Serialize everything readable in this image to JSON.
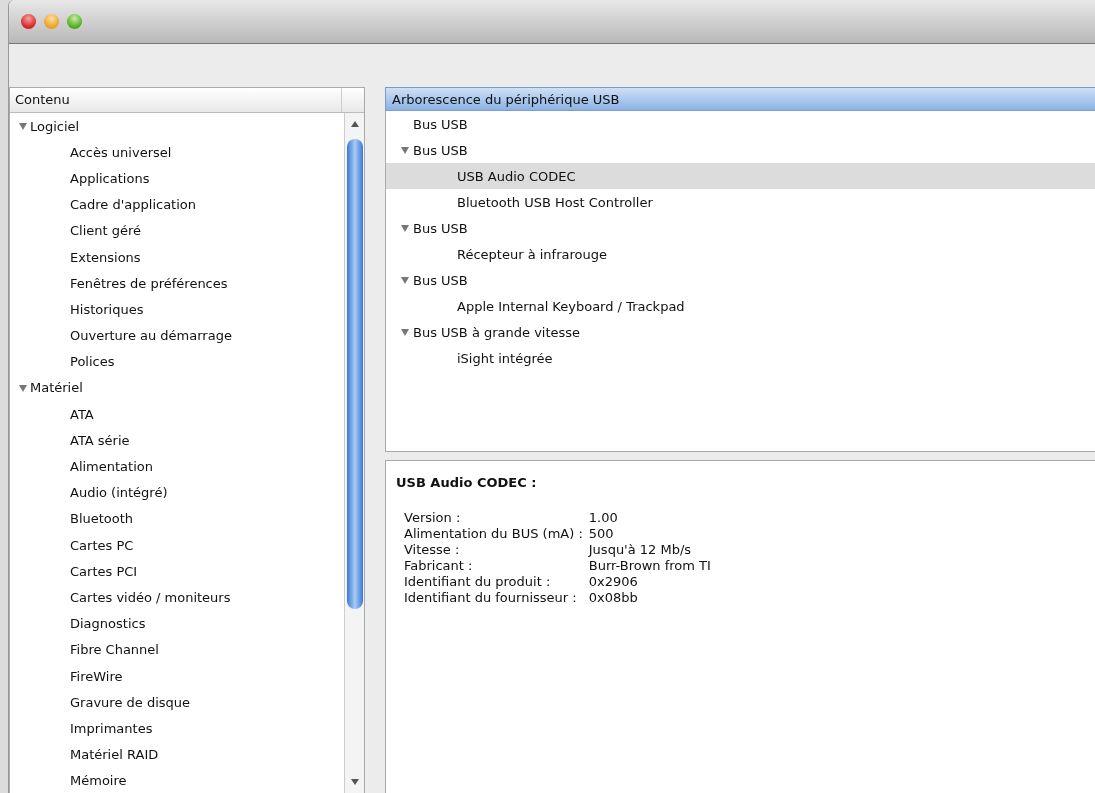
{
  "sidebar": {
    "header": "Contenu",
    "items": [
      {
        "label": "Logiciel",
        "expanded": true,
        "children": [
          {
            "label": "Accès universel"
          },
          {
            "label": "Applications"
          },
          {
            "label": "Cadre d'application"
          },
          {
            "label": "Client géré"
          },
          {
            "label": "Extensions"
          },
          {
            "label": "Fenêtres de préférences"
          },
          {
            "label": "Historiques"
          },
          {
            "label": "Ouverture au démarrage"
          },
          {
            "label": "Polices"
          }
        ]
      },
      {
        "label": "Matériel",
        "expanded": true,
        "children": [
          {
            "label": "ATA"
          },
          {
            "label": "ATA série"
          },
          {
            "label": "Alimentation"
          },
          {
            "label": "Audio (intégré)"
          },
          {
            "label": "Bluetooth"
          },
          {
            "label": "Cartes PC"
          },
          {
            "label": "Cartes PCI"
          },
          {
            "label": "Cartes vidéo / moniteurs"
          },
          {
            "label": "Diagnostics"
          },
          {
            "label": "Fibre Channel"
          },
          {
            "label": "FireWire"
          },
          {
            "label": "Gravure de disque"
          },
          {
            "label": "Imprimantes"
          },
          {
            "label": "Matériel RAID"
          },
          {
            "label": "Mémoire"
          }
        ]
      }
    ]
  },
  "usb_tree": {
    "header": "Arborescence du périphérique USB",
    "items": [
      {
        "label": "Bus USB",
        "selected": false
      },
      {
        "label": "Bus USB",
        "selected": false,
        "expanded": true,
        "children": [
          {
            "label": "USB Audio CODEC",
            "selected": true
          },
          {
            "label": "Bluetooth USB Host Controller",
            "selected": false
          }
        ]
      },
      {
        "label": "Bus USB",
        "selected": false,
        "expanded": true,
        "children": [
          {
            "label": "Récepteur à infrarouge",
            "selected": false
          }
        ]
      },
      {
        "label": "Bus USB",
        "selected": false,
        "expanded": true,
        "children": [
          {
            "label": "Apple Internal Keyboard / Trackpad",
            "selected": false
          }
        ]
      },
      {
        "label": "Bus USB à grande vitesse",
        "selected": false,
        "expanded": true,
        "children": [
          {
            "label": "iSight intégrée",
            "selected": false
          }
        ]
      }
    ]
  },
  "details": {
    "title": "USB Audio CODEC :",
    "properties": [
      {
        "label": "Version :",
        "value": "1.00"
      },
      {
        "label": "Alimentation du BUS (mA) :",
        "value": "500"
      },
      {
        "label": "Vitesse :",
        "value": "Jusqu'à 12 Mb/s"
      },
      {
        "label": "Fabricant :",
        "value": "Burr-Brown from TI"
      },
      {
        "label": "Identifiant du produit :",
        "value": "0x2906"
      },
      {
        "label": "Identifiant du fournisseur :",
        "value": "0x08bb"
      }
    ]
  }
}
